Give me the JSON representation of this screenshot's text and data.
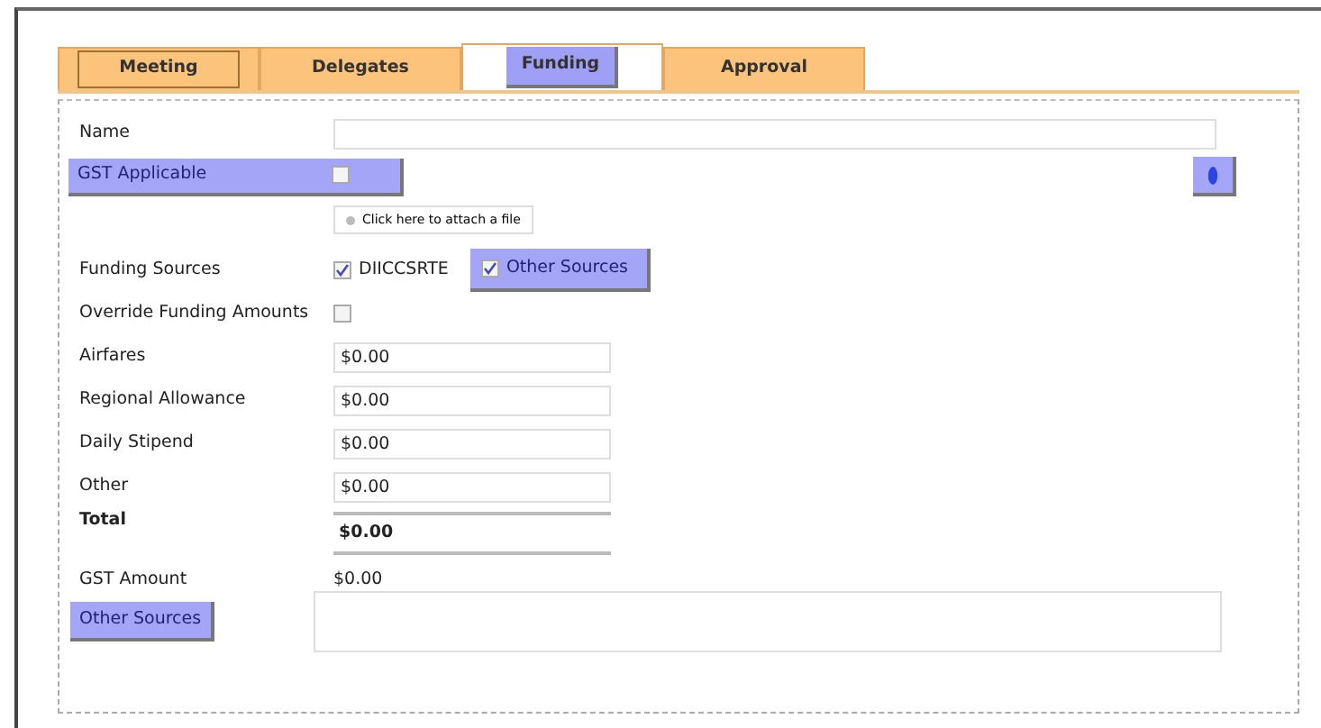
{
  "tabs": [
    {
      "label": "Meeting",
      "selected": false,
      "focused": true
    },
    {
      "label": "Delegates",
      "selected": false,
      "focused": false
    },
    {
      "label": "Funding",
      "selected": true,
      "focused": false
    },
    {
      "label": "Approval",
      "selected": false,
      "focused": false
    }
  ],
  "name_field": {
    "label": "Name"
  },
  "gst_applicable": {
    "label": "GST Applicable",
    "checked": false
  },
  "attach_link": "Click here to attach a file",
  "funding_sources": {
    "label": "Funding Sources",
    "options": [
      {
        "label": "DIICCSRTE",
        "checked": true,
        "highlighted": false
      },
      {
        "label": "Other Sources",
        "checked": true,
        "highlighted": true
      }
    ]
  },
  "override_amounts": {
    "label": "Override Funding Amounts",
    "checked": false
  },
  "amounts": [
    {
      "label": "Airfares",
      "value": "$0.00"
    },
    {
      "label": "Regional Allowance",
      "value": "$0.00"
    },
    {
      "label": "Daily Stipend",
      "value": "$0.00"
    },
    {
      "label": "Other",
      "value": "$0.00"
    }
  ],
  "total": {
    "label": "Total",
    "value": "$0.00"
  },
  "gst_amount": {
    "label": "GST Amount",
    "value": "$0.00"
  },
  "other_sources_button": "Other Sources"
}
